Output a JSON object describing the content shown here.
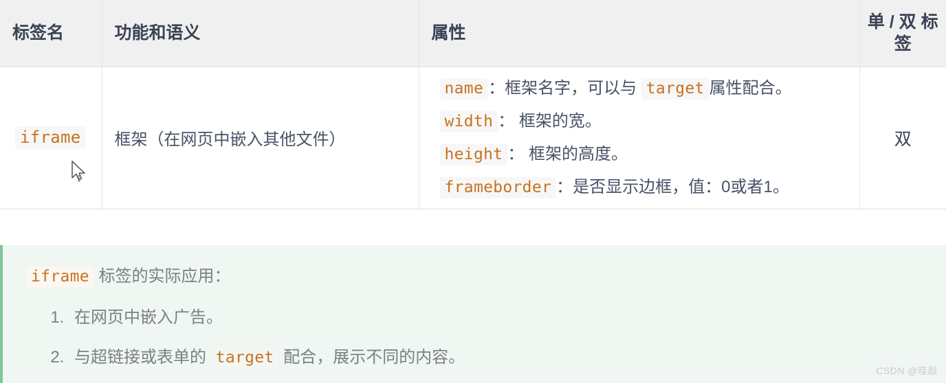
{
  "table": {
    "headers": [
      {
        "label": "标签名"
      },
      {
        "label": "功能和语义"
      },
      {
        "label": "属性"
      },
      {
        "label": "单 / 双 标签"
      }
    ],
    "rows": [
      {
        "tag_name": "iframe",
        "description": "框架（在网页中嵌入其他文件）",
        "attributes": [
          {
            "code": "name",
            "sep": "：",
            "text": "框架名字，可以与",
            "code2": "target",
            "text2": "属性配合。"
          },
          {
            "code": "width",
            "sep": "：",
            "text": " 框架的宽。"
          },
          {
            "code": "height",
            "sep": "：",
            "text": " 框架的高度。"
          },
          {
            "code": "frameborder",
            "sep": "：",
            "text": "是否显示边框，值：0或者1。"
          }
        ],
        "single_or_double": "双"
      }
    ]
  },
  "note": {
    "intro_code": "iframe",
    "intro_text": "标签的实际应用：",
    "items": [
      {
        "text": "在网页中嵌入广告。"
      },
      {
        "prefix": "与超链接或表单的",
        "code": "target",
        "suffix": "配合，展示不同的内容。"
      }
    ]
  },
  "watermark": {
    "text": "CSDN @哇敲"
  },
  "colors": {
    "header_bg": "#f0f0f0",
    "header_text": "#3b4256",
    "body_text": "#4a5268",
    "code_accent": "#c7721f",
    "code_bg": "#f7f7f7",
    "note_bg": "#f0f6f2",
    "note_border": "#7ec699",
    "note_text": "#7a8086",
    "grid_line": "#e6e6e6",
    "watermark": "#c9cdd2"
  }
}
